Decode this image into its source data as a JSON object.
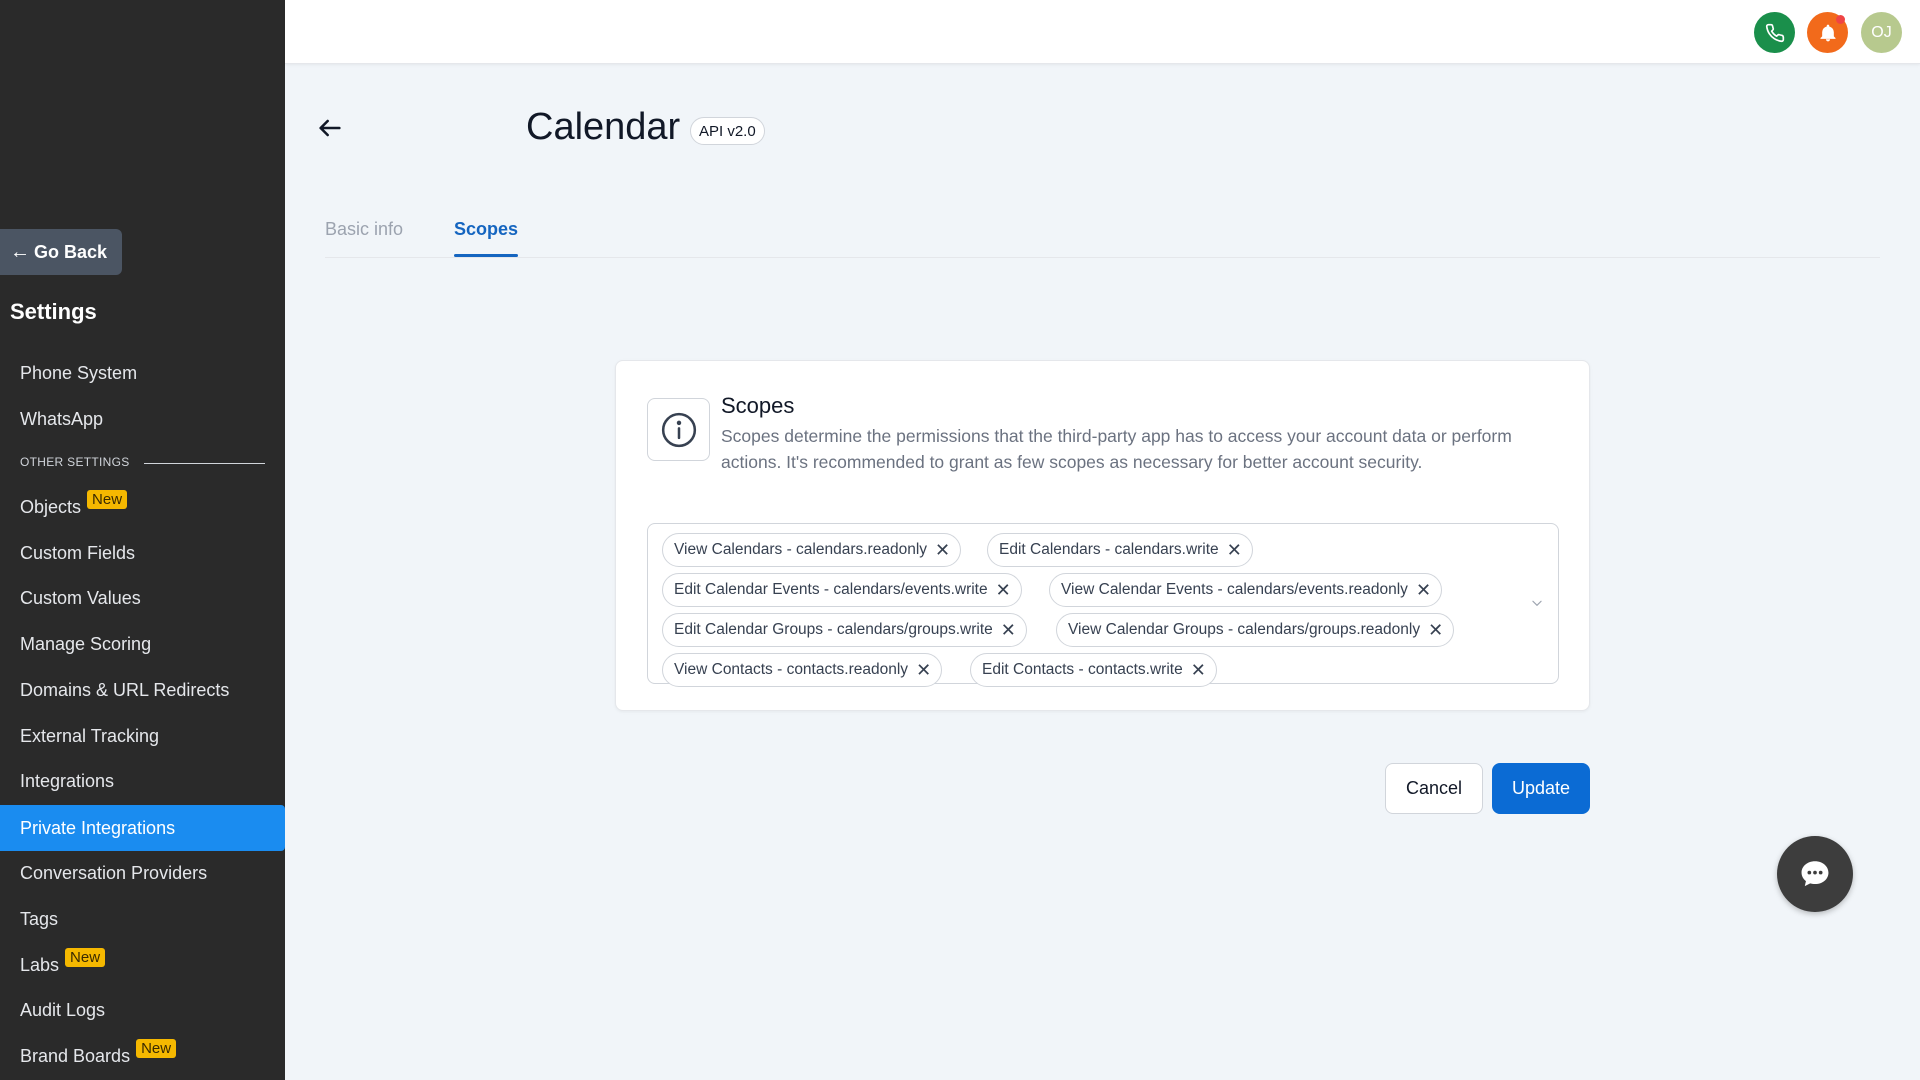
{
  "sidebar": {
    "go_back": "Go Back",
    "title": "Settings",
    "items_top": [
      {
        "label": "Phone System"
      },
      {
        "label": "WhatsApp"
      }
    ],
    "section_label": "OTHER SETTINGS",
    "items": [
      {
        "label": "Objects",
        "badge": "New"
      },
      {
        "label": "Custom Fields"
      },
      {
        "label": "Custom Values"
      },
      {
        "label": "Manage Scoring"
      },
      {
        "label": "Domains & URL Redirects"
      },
      {
        "label": "External Tracking"
      },
      {
        "label": "Integrations"
      },
      {
        "label": "Private Integrations",
        "active": true
      },
      {
        "label": "Conversation Providers"
      },
      {
        "label": "Tags"
      },
      {
        "label": "Labs",
        "badge": "New"
      },
      {
        "label": "Audit Logs"
      },
      {
        "label": "Brand Boards",
        "badge": "New"
      }
    ]
  },
  "topbar": {
    "avatar_initials": "OJ",
    "icons": [
      "phone-icon",
      "bell-icon"
    ]
  },
  "header": {
    "title": "Calendar",
    "api_badge": "API v2.0"
  },
  "tabs": [
    {
      "label": "Basic info",
      "active": false
    },
    {
      "label": "Scopes",
      "active": true
    }
  ],
  "scopes_card": {
    "title": "Scopes",
    "description": "Scopes determine the permissions that the third-party app has to access your account data or perform actions. It's recommended to grant as few scopes as necessary for better account security.",
    "chips": [
      "View Calendars - calendars.readonly",
      "Edit Calendars - calendars.write",
      "Edit Calendar Events - calendars/events.write",
      "View Calendar Events - calendars/events.readonly",
      "Edit Calendar Groups - calendars/groups.write",
      "View Calendar Groups - calendars/groups.readonly",
      "View Contacts - contacts.readonly",
      "Edit Contacts - contacts.write"
    ]
  },
  "actions": {
    "cancel": "Cancel",
    "update": "Update"
  },
  "colors": {
    "sidebar_bg": "#2a2a2a",
    "active_item": "#1a8cf0",
    "primary": "#0b6bd4",
    "badge": "#f5b800",
    "phone": "#1a8f4b",
    "bell": "#f26a1b"
  }
}
